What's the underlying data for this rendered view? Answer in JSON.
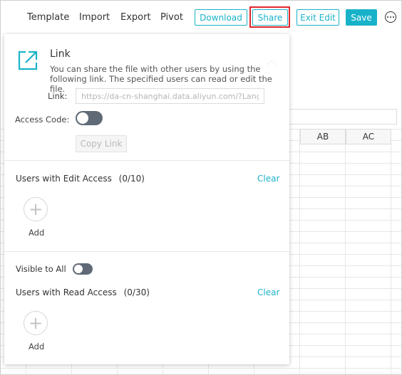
{
  "toolbar": {
    "template_label": "Template",
    "import_label": "Import",
    "export_label": "Export",
    "pivot_label": "Pivot",
    "download_label": "Download",
    "share_label": "Share",
    "exit_edit_label": "Exit Edit",
    "save_label": "Save",
    "more_icon": "ellipsis-circle-icon"
  },
  "sheet": {
    "columns": [
      "AB",
      "AC"
    ]
  },
  "share_panel": {
    "link_icon": "external-link-icon",
    "link_title": "Link",
    "link_description": "You can share the file with other users by using the following link. The specified users can read or edit the file.",
    "link_label": "Link:",
    "link_placeholder": "https://da-cn-shanghai.data.aliyun.com/?Lang",
    "access_code_label": "Access Code:",
    "copy_link_label": "Copy Link",
    "edit_access_title": "Users with Edit Access",
    "edit_access_count": "(0/10)",
    "edit_clear_label": "Clear",
    "edit_add_label": "Add",
    "visible_to_all_label": "Visible to All",
    "read_access_title": "Users with Read Access",
    "read_access_count": "(0/30)",
    "read_clear_label": "Clear",
    "read_add_label": "Add"
  },
  "colors": {
    "accent": "#1bb3c9",
    "highlight": "#e0262c",
    "toggle_off": "#5f6a76"
  }
}
